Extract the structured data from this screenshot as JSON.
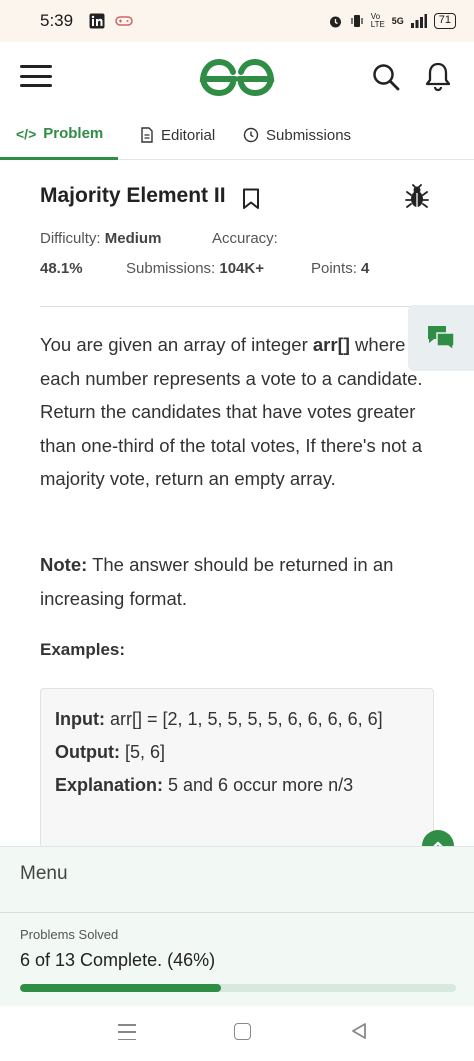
{
  "status_bar": {
    "time": "5:39",
    "network": "5G",
    "lte": "Vo LTE",
    "battery": "71"
  },
  "header": {
    "logo": "GeeksforGeeks logo",
    "icons": [
      "menu-icon",
      "search-icon",
      "bell-icon"
    ]
  },
  "tabs": [
    {
      "label": "Problem",
      "icon": "code-icon",
      "active": true
    },
    {
      "label": "Editorial",
      "icon": "document-icon",
      "active": false
    },
    {
      "label": "Submissions",
      "icon": "clock-icon",
      "active": false
    }
  ],
  "problem": {
    "title": "Majority Element II",
    "difficulty_label": "Difficulty:",
    "difficulty_value": "Medium",
    "accuracy_label": "Accuracy:",
    "accuracy_value": "48.1%",
    "submissions_label": "Submissions:",
    "submissions_value": "104K+",
    "points_label": "Points:",
    "points_value": "4",
    "description_pre": "You are given an array of integer ",
    "description_code": "arr[]",
    "description_post": " where each number represents a vote to a candidate. Return the candidates that have votes greater than one-third of the total votes, If there's not a majority vote, return an empty array.",
    "note_label": "Note:",
    "note_text": " The answer should be returned in an increasing format.",
    "examples_heading": "Examples:",
    "example": {
      "input_label": "Input:",
      "input_value": " arr[]  =  [2,  1,  5,  5,  5,  5,  6,  6,  6,  6,  6]",
      "output_label": "Output:",
      "output_value": "  [5,  6]",
      "explanation_label": "Explanation:",
      "explanation_value": "  5  and  6  occur  more  n/3"
    }
  },
  "menu": {
    "title": "Menu",
    "problems_solved_label": "Problems Solved",
    "solved_text": "6 of 13 Complete. (46%)",
    "progress_percent": 46
  },
  "colors": {
    "brand_green": "#2f8d46",
    "status_bg": "#fbf5ee",
    "menu_bg": "#f2f8f4"
  }
}
